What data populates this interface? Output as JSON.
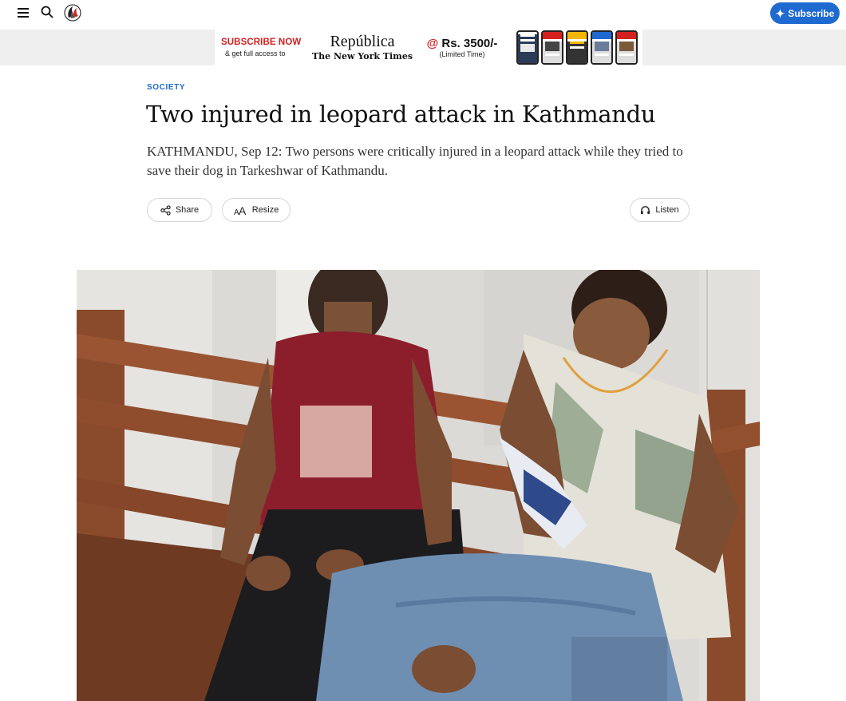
{
  "header": {
    "subscribe_label": "Subscribe"
  },
  "banner": {
    "subscribe_now": "SUBSCRIBE NOW",
    "get_access": "& get full access to",
    "publication": "República",
    "partner": "The New York Times",
    "price_at": "@",
    "price": "Rs. 3500/-",
    "limited": "(Limited Time)"
  },
  "article": {
    "category": "SOCIETY",
    "title": "Two injured in leopard attack in Kathmandu",
    "lede": "KATHMANDU, Sep 12: Two persons were critically injured in a leopard attack while they tried to save their dog in Tarkeshwar of Kathmandu."
  },
  "actions": {
    "share_label": "Share",
    "resize_label": "Resize",
    "listen_label": "Listen"
  },
  "colors": {
    "accent": "#1f6ad1",
    "banner_red": "#d52020"
  },
  "icons": [
    "menu-icon",
    "search-icon",
    "logo",
    "plus-icon",
    "share-icon",
    "text-resize-icon",
    "headphones-icon"
  ]
}
